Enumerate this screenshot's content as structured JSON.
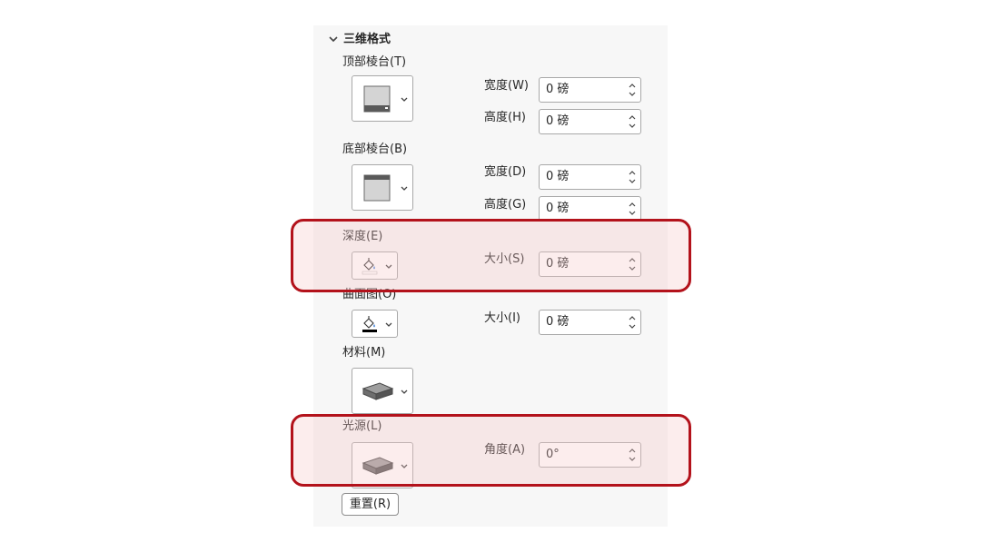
{
  "section": {
    "title": "三维格式"
  },
  "top_bevel": {
    "label": "顶部棱台(T)",
    "width_label": "宽度(W)",
    "width_value": "0 磅",
    "height_label": "高度(H)",
    "height_value": "0 磅"
  },
  "bottom_bevel": {
    "label": "底部棱台(B)",
    "width_label": "宽度(D)",
    "width_value": "0 磅",
    "height_label": "高度(G)",
    "height_value": "0 磅"
  },
  "depth": {
    "label": "深度(E)",
    "size_label": "大小(S)",
    "size_value": "0 磅"
  },
  "contour": {
    "label": "曲面图(O)",
    "size_label": "大小(I)",
    "size_value": "0 磅"
  },
  "material": {
    "label": "材料(M)"
  },
  "lighting": {
    "label": "光源(L)",
    "angle_label": "角度(A)",
    "angle_value": "0°"
  },
  "reset_button": {
    "label": "重置(R)"
  },
  "colors": {
    "highlight": "#b3121b",
    "highlight_fill": "#f6c8c8",
    "panel_bg": "#f7f7f7"
  }
}
